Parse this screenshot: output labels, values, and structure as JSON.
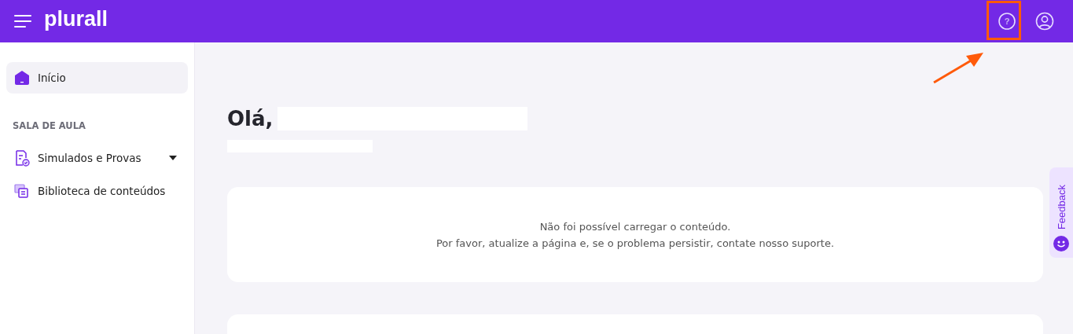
{
  "header": {
    "logo": "plurall",
    "help": "?"
  },
  "sidebar": {
    "items": [
      {
        "label": "Início",
        "selected": true,
        "kind": "home"
      }
    ],
    "section": {
      "title": "SALA DE AULA",
      "items": [
        {
          "label": "Simulados e Provas",
          "kind": "exam",
          "expandable": true,
          "selected": false
        },
        {
          "label": "Biblioteca de conteúdos",
          "kind": "library",
          "expandable": false,
          "selected": false
        }
      ]
    }
  },
  "main": {
    "greeting": "Olá,",
    "message": [
      "Não foi possível carregar o conteúdo.",
      "Por favor, atualize a página e, se o problema persistir, contate nosso suporte."
    ]
  },
  "feedback": {
    "label": "Feedback"
  },
  "annotation": {
    "highlight_box": true,
    "arrow": true
  }
}
